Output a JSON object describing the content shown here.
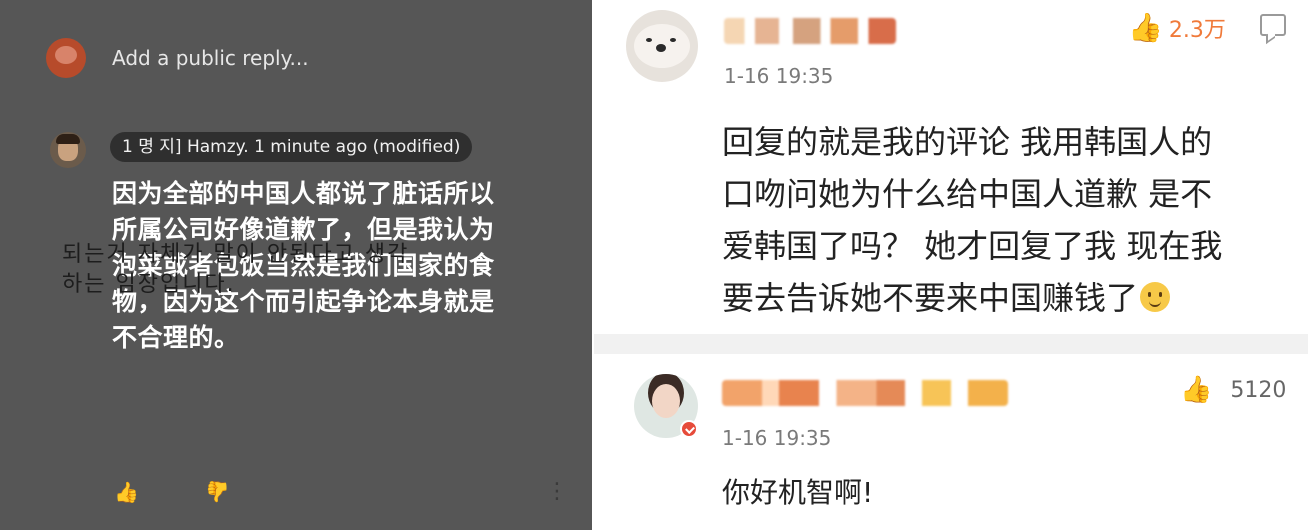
{
  "left_panel": {
    "reply_placeholder": "Add a public reply...",
    "comment_meta": "1 명 지] Hamzy. 1 minute ago (modified)",
    "overlay_text": "因为全部的中国人都说了脏话所以\n所属公司好像道歉了，但是我认为\n泡菜或者包饭当然是我们国家的食\n物，因为这个而引起争论本身就是\n不合理的。",
    "korean_text": "되는거 자체가 말이 안된다고 생각\n하는 임장입니다."
  },
  "right_panel": {
    "comment1": {
      "time": "1-16 19:35",
      "like_count": "2.3万",
      "text": "回复的就是我的评论 我用韩国人的\n口吻问她为什么给中国人道歉 是不\n爱韩国了吗？ 她才回复了我 现在我\n要去告诉她不要来中国赚钱了"
    },
    "comment2": {
      "time": "1-16 19:35",
      "like_count": "5120",
      "text": "你好机智啊!"
    }
  },
  "icons": {
    "thumb": "👍",
    "thumb_down": "👍",
    "more": "⋮"
  }
}
